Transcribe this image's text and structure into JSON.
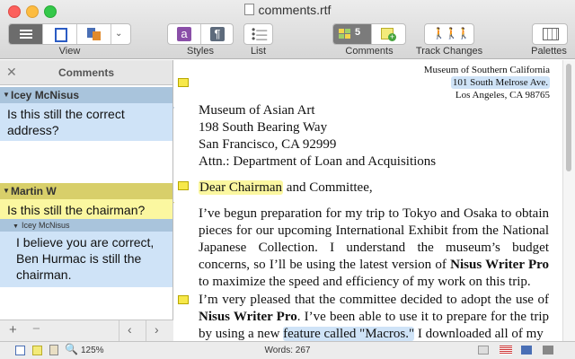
{
  "window": {
    "title": "comments.rtf"
  },
  "toolbar": {
    "view_label": "View",
    "styles_label": "Styles",
    "list_label": "List",
    "comments_label": "Comments",
    "comments_count": "5",
    "track_changes_label": "Track Changes",
    "palettes_label": "Palettes"
  },
  "sidebar": {
    "title": "Comments",
    "comments": [
      {
        "author": "Icey McNisus",
        "text": "Is this still the correct address?"
      },
      {
        "author": "Martin W",
        "text": "Is this still the chairman?",
        "reply": {
          "author": "Icey McNisus",
          "text": "I believe you are correct, Ben Hurmac is still the chairman."
        }
      }
    ]
  },
  "document": {
    "return_address": [
      "Museum of Southern California",
      "101 South Melrose Ave.",
      "Los Angeles, CA 98765"
    ],
    "recipient": [
      "Museum of Asian Art",
      "198 South Bearing Way",
      "San Francisco, CA 92999",
      "Attn.: Department of Loan and Acquisitions"
    ],
    "salutation_highlight": "Dear Chairman",
    "salutation_rest": " and Committee,",
    "p1_a": "I’ve begun preparation for my trip to Tokyo and Osaka to obtain pieces for our upcoming International Exhibit from the National Japanese Collection. I understand the museum’s budget concerns, so I’ll be using the latest version of ",
    "p1_bold": "Nisus Writer Pro",
    "p1_b": " to maximize the speed and efficiency of my work on this trip.",
    "p2_a": "I’m very pleased that the committee decided to adopt the use of ",
    "p2_bold": "Nisus Writer Pro",
    "p2_b": ". I’ve been able to use it to prepare for the trip by using a new ",
    "p2_highlight": "feature called \"Macros.\"",
    "p2_c": " I downloaded all of my"
  },
  "statusbar": {
    "zoom": "125%",
    "words": "Words: 267"
  },
  "colors": {
    "comment_blue": "#cfe3f7",
    "comment_yellow": "#fbf7a0",
    "author_blue_bar": "#a9c4dc",
    "author_yellow_bar": "#d8cf6a"
  },
  "icons": [
    "close-icon",
    "view-list-icon",
    "view-page-icon",
    "view-draft-icon",
    "styles-icon",
    "paragraph-icon",
    "list-icon",
    "comments-icon",
    "add-comment-icon",
    "track-changes-icon",
    "palettes-icon",
    "add-icon",
    "remove-icon",
    "previous-icon",
    "next-icon",
    "zoom-icon"
  ]
}
